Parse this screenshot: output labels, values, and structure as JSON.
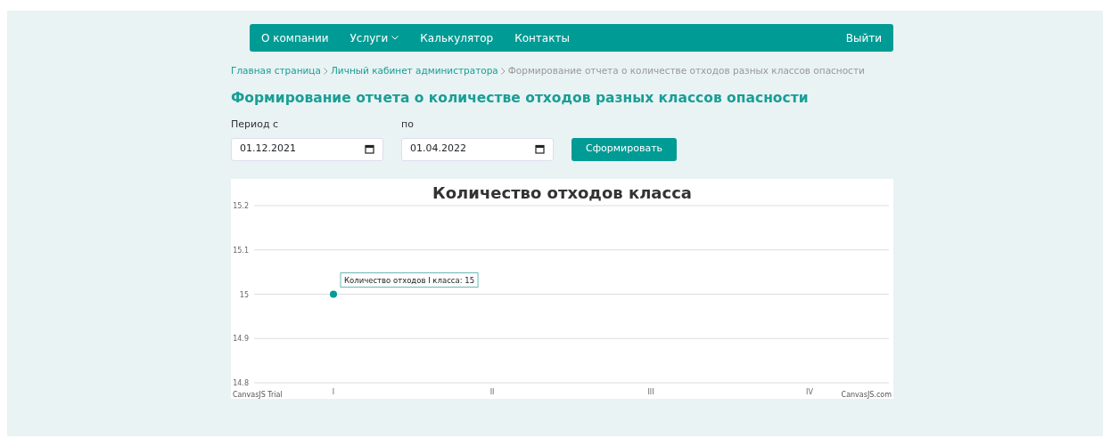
{
  "navbar": {
    "items": [
      {
        "label": "О компании",
        "dropdown": false
      },
      {
        "label": "Услуги",
        "dropdown": true
      },
      {
        "label": "Калькулятор",
        "dropdown": false
      },
      {
        "label": "Контакты",
        "dropdown": false
      }
    ],
    "logout": "Выйти"
  },
  "breadcrumb": [
    {
      "label": "Главная страница",
      "current": false
    },
    {
      "label": "Личный кабинет администратора",
      "current": false
    },
    {
      "label": "Формирование отчета о количестве отходов разных классов опасности",
      "current": true
    }
  ],
  "title": "Формирование отчета о количестве отходов разных классов опасности",
  "form": {
    "from_label": "Период с",
    "from_value": "01.12.2021",
    "to_label": "по",
    "to_value": "01.04.2022",
    "submit": "Сформировать"
  },
  "chart": {
    "chart_data": {
      "type": "line",
      "title": "Количество отходов класса",
      "categories": [
        "I",
        "II",
        "III",
        "IV"
      ],
      "grid": true,
      "series": [
        {
          "color": "#009b95",
          "marker": true,
          "values": [
            15,
            null,
            null,
            null
          ]
        }
      ],
      "ylim": [
        14.8,
        15.2
      ],
      "yticks": [
        14.8,
        14.9,
        {
          "value": 15,
          "label": "15"
        },
        15.1,
        15.2
      ]
    },
    "tooltip": "Количество отходов I класса: 15",
    "credit_left": "CanvasJS Trial",
    "credit_right": "CanvasJS.com"
  }
}
